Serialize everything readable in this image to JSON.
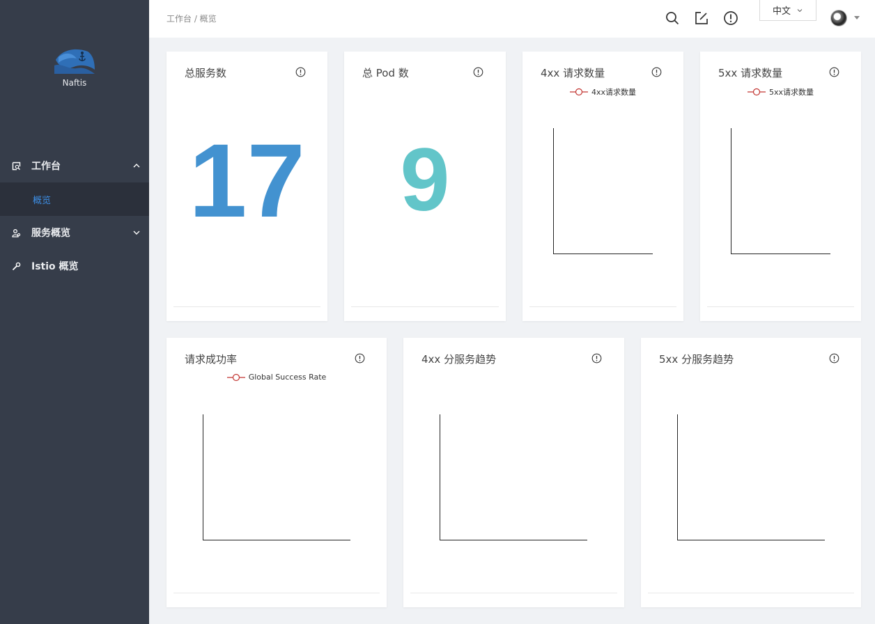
{
  "sidebar": {
    "brand": "Naftis",
    "menu": [
      {
        "label": "工作台",
        "icon": "dashboard-icon"
      },
      {
        "label": "服务概览",
        "icon": "services-icon"
      },
      {
        "label": "Istio 概览",
        "icon": "wrench-icon"
      }
    ],
    "submenu_active": "概览"
  },
  "header": {
    "breadcrumb": "工作台 / 概览",
    "language": "中文",
    "icons": [
      "search-icon",
      "edit-icon",
      "alert-icon"
    ]
  },
  "cards": {
    "total_services": {
      "title": "总服务数",
      "value": "17",
      "color": "#4392d0"
    },
    "total_pods": {
      "title": "总 Pod 数",
      "value": "9",
      "color": "#62c5c9"
    },
    "req_4xx": {
      "title": "4xx 请求数量",
      "legend": "4xx请求数量"
    },
    "req_5xx": {
      "title": "5xx 请求数量",
      "legend": "5xx请求数量"
    },
    "success_rate": {
      "title": "请求成功率",
      "legend": "Global Success Rate"
    },
    "trend_4xx": {
      "title": "4xx 分服务趋势"
    },
    "trend_5xx": {
      "title": "5xx 分服务趋势"
    }
  },
  "colors": {
    "sidebar": "#363d4a",
    "accent": "#3d8ee5",
    "legend_line": "#c23531"
  }
}
